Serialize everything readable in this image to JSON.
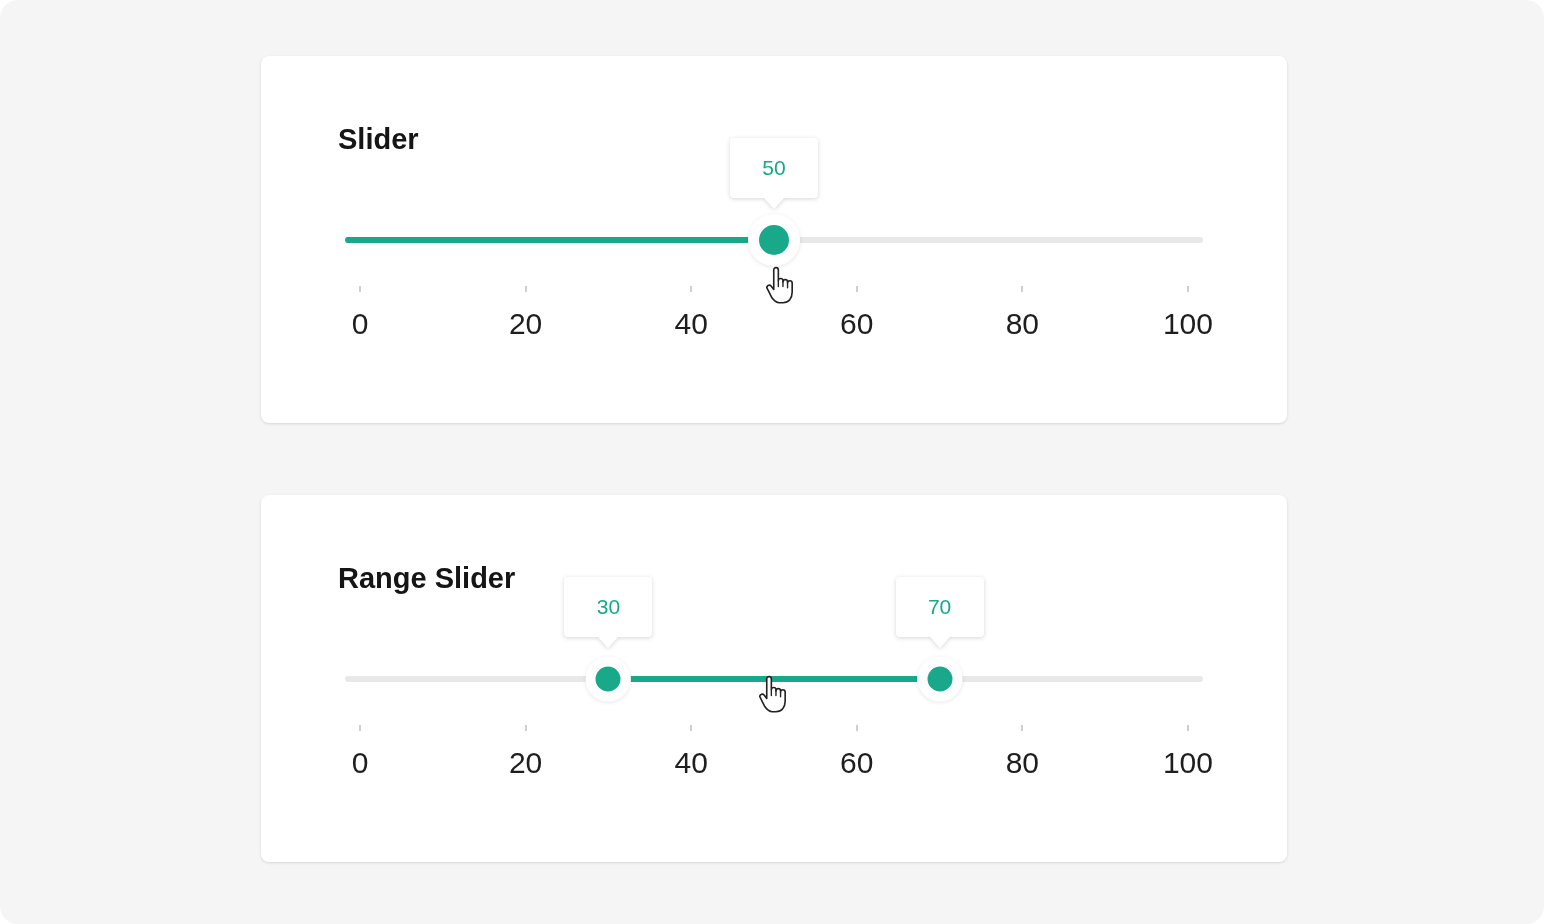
{
  "sliders": [
    {
      "title": "Slider",
      "kind": "single",
      "thumbs": [
        {
          "level": 0.5,
          "reading": "50"
        }
      ],
      "ticks": [
        "0",
        "20",
        "40",
        "60",
        "80",
        "100"
      ]
    },
    {
      "title": "Range Slider",
      "kind": "range",
      "thumbs": [
        {
          "level": 0.3,
          "reading": "30"
        },
        {
          "level": 0.7,
          "reading": "70"
        }
      ],
      "ticks": [
        "0",
        "20",
        "40",
        "60",
        "80",
        "100"
      ]
    }
  ]
}
